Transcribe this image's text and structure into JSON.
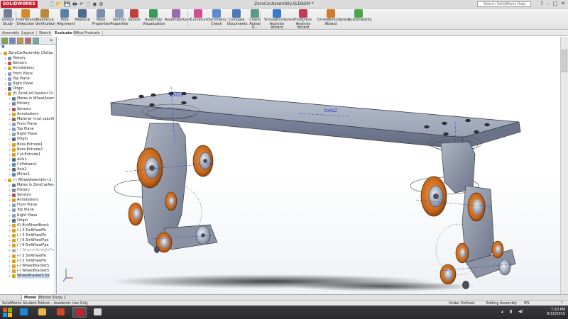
{
  "titlebar": {
    "logo": "SOLIDWORKS",
    "document_title": "ZeroCarAssembly.SLDASM *",
    "search_placeholder": "Search SolidWorks Help",
    "qat_icons": [
      "new-icon",
      "open-icon",
      "save-icon",
      "print-icon",
      "undo-icon",
      "select-icon",
      "rebuild-icon",
      "options-icon"
    ]
  },
  "ribbon": {
    "buttons": [
      {
        "label": "Design Study",
        "icon": "design-study-icon",
        "color": "#6f7f9b"
      },
      {
        "label": "Interference Detection",
        "icon": "interference-icon",
        "color": "#d68a2a"
      },
      {
        "label": "Clearance Verification",
        "icon": "clearance-icon",
        "color": "#b88a3a"
      },
      {
        "label": "Hole Alignment",
        "icon": "hole-alignment-icon",
        "color": "#5d7fa6"
      },
      {
        "label": "Measure",
        "icon": "measure-icon",
        "color": "#4d6d8f"
      },
      {
        "label": "Mass Properties",
        "icon": "mass-properties-icon",
        "color": "#7d8fb0"
      },
      {
        "label": "Section Properties",
        "icon": "section-properties-icon",
        "color": "#8a9fbf"
      },
      {
        "label": "Sensor",
        "icon": "sensor-icon",
        "color": "#c04040"
      },
      {
        "label": "Assembly Visualization",
        "icon": "assembly-visualization-icon",
        "color": "#3a9a5a"
      },
      {
        "label": "AssemblyXpert",
        "icon": "assemblyxpert-icon",
        "color": "#9a6ab0"
      },
      {
        "label": "Curvature",
        "icon": "curvature-icon",
        "color": "#d05090"
      },
      {
        "label": "Symmetry Check",
        "icon": "symmetry-check-icon",
        "color": "#5a8acf"
      },
      {
        "label": "Compare Documents",
        "icon": "compare-documents-icon",
        "color": "#4f78b8"
      },
      {
        "label": "Check Active D...",
        "icon": "check-active-icon",
        "color": "#5a9a8a"
      },
      {
        "label": "SimulationXpress Analysis Wizard",
        "icon": "simulationxpress-icon",
        "color": "#3a7ac8"
      },
      {
        "label": "FloXpress Analysis Wizard",
        "icon": "floxpress-icon",
        "color": "#c03a5a"
      },
      {
        "label": "DriveWorksXpress Wizard",
        "icon": "driveworksxpress-icon",
        "color": "#d07a2a"
      },
      {
        "label": "Sustainability",
        "icon": "sustainability-icon",
        "color": "#4aa84a"
      }
    ]
  },
  "command_tabs": [
    {
      "label": "Assembly",
      "active": false
    },
    {
      "label": "Layout",
      "active": false
    },
    {
      "label": "Sketch",
      "active": false
    },
    {
      "label": "Evaluate",
      "active": true
    },
    {
      "label": "Office Products",
      "active": false
    }
  ],
  "view_tools": [
    "zoom-to-fit-icon",
    "zoom-area-icon",
    "previous-view-icon",
    "section-view-icon",
    "view-orientation-icon",
    "display-style-icon",
    "hide-show-icon",
    "edit-appearance-icon",
    "scene-icon",
    "view-settings-icon"
  ],
  "feature_tree": {
    "filter_icon": "filter-icon",
    "items": [
      {
        "label": "ZeroCarAssembly  (Defau",
        "level": 0,
        "icon": "assembly-icon",
        "color": "#d9a21a",
        "selected": false
      },
      {
        "label": "History",
        "level": 1,
        "icon": "history-icon",
        "color": "#7a8aa0",
        "selected": false
      },
      {
        "label": "Sensors",
        "level": 1,
        "icon": "sensors-icon",
        "color": "#c0504d",
        "selected": false
      },
      {
        "label": "Annotations",
        "level": 1,
        "icon": "annotations-icon",
        "color": "#d9a21a",
        "selected": false
      },
      {
        "label": "Front Plane",
        "level": 1,
        "icon": "plane-icon",
        "color": "#8aa0c0",
        "selected": false
      },
      {
        "label": "Top Plane",
        "level": 1,
        "icon": "plane-icon",
        "color": "#8aa0c0",
        "selected": false
      },
      {
        "label": "Right Plane",
        "level": 1,
        "icon": "plane-icon",
        "color": "#8aa0c0",
        "selected": false
      },
      {
        "label": "Origin",
        "level": 1,
        "icon": "origin-icon",
        "color": "#5a6a80",
        "selected": false
      },
      {
        "label": "(f) ZeroCarChassis<1>",
        "level": 1,
        "icon": "part-icon",
        "color": "#d9a21a",
        "selected": false
      },
      {
        "label": "Mates in WheelAssem",
        "level": 2,
        "icon": "mates-icon",
        "color": "#6a7a90",
        "selected": false
      },
      {
        "label": "History",
        "level": 2,
        "icon": "history-icon",
        "color": "#7a8aa0",
        "selected": false
      },
      {
        "label": "Sensors",
        "level": 2,
        "icon": "sensors-icon",
        "color": "#c0504d",
        "selected": false
      },
      {
        "label": "Annotations",
        "level": 2,
        "icon": "annotations-icon",
        "color": "#d9a21a",
        "selected": false
      },
      {
        "label": "Material <not specifie",
        "level": 2,
        "icon": "material-icon",
        "color": "#8a6a4a",
        "selected": false
      },
      {
        "label": "Front Plane",
        "level": 2,
        "icon": "plane-icon",
        "color": "#8aa0c0",
        "selected": false
      },
      {
        "label": "Top Plane",
        "level": 2,
        "icon": "plane-icon",
        "color": "#8aa0c0",
        "selected": false
      },
      {
        "label": "Right Plane",
        "level": 2,
        "icon": "plane-icon",
        "color": "#8aa0c0",
        "selected": false
      },
      {
        "label": "Origin",
        "level": 2,
        "icon": "origin-icon",
        "color": "#5a6a80",
        "selected": false
      },
      {
        "label": "Boss-Extrude1",
        "level": 2,
        "icon": "extrude-icon",
        "color": "#d9a21a",
        "selected": false
      },
      {
        "label": "Boss-Extrude2",
        "level": 2,
        "icon": "extrude-icon",
        "color": "#d9a21a",
        "selected": false
      },
      {
        "label": "Cut-Extrude1",
        "level": 2,
        "icon": "cut-extrude-icon",
        "color": "#d9a21a",
        "selected": false
      },
      {
        "label": "Axis1",
        "level": 2,
        "icon": "axis-icon",
        "color": "#5a6a80",
        "selected": false
      },
      {
        "label": "CirPattern1",
        "level": 2,
        "icon": "pattern-icon",
        "color": "#5a8ac0",
        "selected": false
      },
      {
        "label": "Axis2",
        "level": 2,
        "icon": "axis-icon",
        "color": "#5a6a80",
        "selected": false
      },
      {
        "label": "Mirror1",
        "level": 2,
        "icon": "mirror-icon",
        "color": "#5a8ac0",
        "selected": false
      },
      {
        "label": "(-) WheelAssembly<2",
        "level": 1,
        "icon": "subassembly-icon",
        "color": "#d9a21a",
        "selected": false
      },
      {
        "label": "Mates in ZeroCarAsse",
        "level": 2,
        "icon": "mates-icon",
        "color": "#6a7a90",
        "selected": false
      },
      {
        "label": "History",
        "level": 2,
        "icon": "history-icon",
        "color": "#7a8aa0",
        "selected": false
      },
      {
        "label": "Sensors",
        "level": 2,
        "icon": "sensors-icon",
        "color": "#c0504d",
        "selected": false
      },
      {
        "label": "Annotations",
        "level": 2,
        "icon": "annotations-icon",
        "color": "#d9a21a",
        "selected": false
      },
      {
        "label": "Front Plane",
        "level": 2,
        "icon": "plane-icon",
        "color": "#8aa0c0",
        "selected": false
      },
      {
        "label": "Top Plane",
        "level": 2,
        "icon": "plane-icon",
        "color": "#8aa0c0",
        "selected": false
      },
      {
        "label": "Right Plane",
        "level": 2,
        "icon": "plane-icon",
        "color": "#8aa0c0",
        "selected": false
      },
      {
        "label": "Origin",
        "level": 2,
        "icon": "origin-icon",
        "color": "#5a6a80",
        "selected": false
      },
      {
        "label": "(f) 8inWheelBrack",
        "level": 2,
        "icon": "part-icon",
        "color": "#d9a21a",
        "selected": false
      },
      {
        "label": "(-) 3.5inWheelFe",
        "level": 2,
        "icon": "part-icon",
        "color": "#d9a21a",
        "selected": false
      },
      {
        "label": "(-) 3.5inWheelFe",
        "level": 2,
        "icon": "part-icon",
        "color": "#d9a21a",
        "selected": false
      },
      {
        "label": "(-) 6.5inWheelFpe",
        "level": 2,
        "icon": "part-icon",
        "color": "#d9a21a",
        "selected": false
      },
      {
        "label": "(-) 6.5inWheelFpe",
        "level": 2,
        "icon": "part-icon",
        "color": "#d9a21a",
        "selected": false
      },
      {
        "label": "(-) WrenchStraightFlat",
        "level": 2,
        "icon": "part-icon",
        "color": "#b0b0b0",
        "selected": false,
        "grey": true
      },
      {
        "label": "(-) 3.5inWheelFe",
        "level": 2,
        "icon": "part-icon",
        "color": "#d9a21a",
        "selected": false
      },
      {
        "label": "(-) 3.5inWheelFe",
        "level": 2,
        "icon": "part-icon",
        "color": "#d9a21a",
        "selected": false
      },
      {
        "label": "(-) WheelBracket5",
        "level": 2,
        "icon": "part-icon",
        "color": "#d9a21a",
        "selected": false
      },
      {
        "label": "(-) WheelBracket5",
        "level": 2,
        "icon": "part-icon",
        "color": "#d9a21a",
        "selected": false
      },
      {
        "label": "WheelBracket5.5ir",
        "level": 2,
        "icon": "part-icon",
        "color": "#d9a21a",
        "selected": true
      }
    ]
  },
  "bottom_tabs": [
    {
      "label": "Model",
      "active": true
    },
    {
      "label": "Motion Study 1",
      "active": false
    }
  ],
  "viewport": {
    "axis_labels": [
      "Axis1",
      "Axis2"
    ],
    "accent_orange": "#c8661c",
    "chassis_color": "#9aa2b5"
  },
  "statusbar": {
    "left": "SolidWorks Student Edition - Academic Use Only",
    "state": "Under Defined",
    "mode": "Editing Assembly",
    "units": "IPS",
    "help_icon": "help-icon"
  },
  "taskbar": {
    "time": "7:10 PM",
    "date": "6/10/2015",
    "apps": [
      {
        "icon": "ie-icon",
        "color": "#1e88d8",
        "active": false
      },
      {
        "icon": "explorer-icon",
        "color": "#e8b84a",
        "active": false
      },
      {
        "icon": "powerpoint-icon",
        "color": "#d2462a",
        "active": false
      },
      {
        "icon": "solidworks-icon",
        "color": "#c8202f",
        "active": true
      },
      {
        "icon": "media-icon",
        "color": "#d8d8d8",
        "active": false
      }
    ]
  }
}
